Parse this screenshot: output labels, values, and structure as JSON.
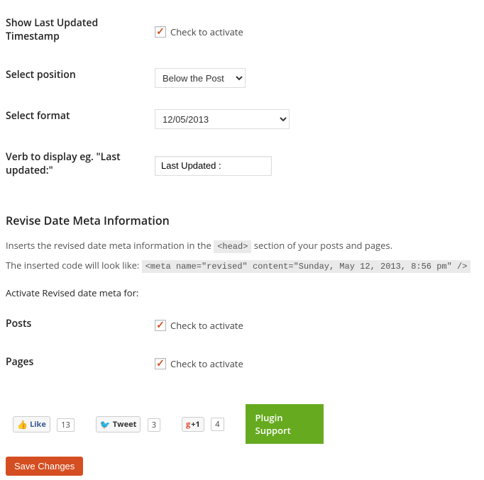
{
  "fields": {
    "show_timestamp": {
      "label": "Show Last Updated Timestamp",
      "cb_label": "Check to activate",
      "checked": true
    },
    "position": {
      "label": "Select position",
      "value": "Below the Post"
    },
    "format": {
      "label": "Select format",
      "value": "12/05/2013"
    },
    "verb": {
      "label": "Verb to display eg. \"Last updated:\"",
      "value": "Last Updated :"
    }
  },
  "meta_section": {
    "heading": "Revise Date Meta Information",
    "desc_pre": "Inserts the revised date meta information in the ",
    "desc_code1": "<head>",
    "desc_post": " section of your posts and pages.",
    "desc2_pre": "The inserted code will look like: ",
    "desc2_code": "<meta name=\"revised\" content=\"Sunday, May 12, 2013, 8:56 pm\" />",
    "activate_label": "Activate Revised date meta for:",
    "posts": {
      "label": "Posts",
      "cb_label": "Check to activate",
      "checked": true
    },
    "pages": {
      "label": "Pages",
      "cb_label": "Check to activate",
      "checked": true
    }
  },
  "social": {
    "like_label": "Like",
    "like_count": "13",
    "tweet_label": "Tweet",
    "tweet_count": "3",
    "gplus_label": "+1",
    "gplus_count": "4",
    "support": "Plugin Support"
  },
  "save": "Save Changes"
}
